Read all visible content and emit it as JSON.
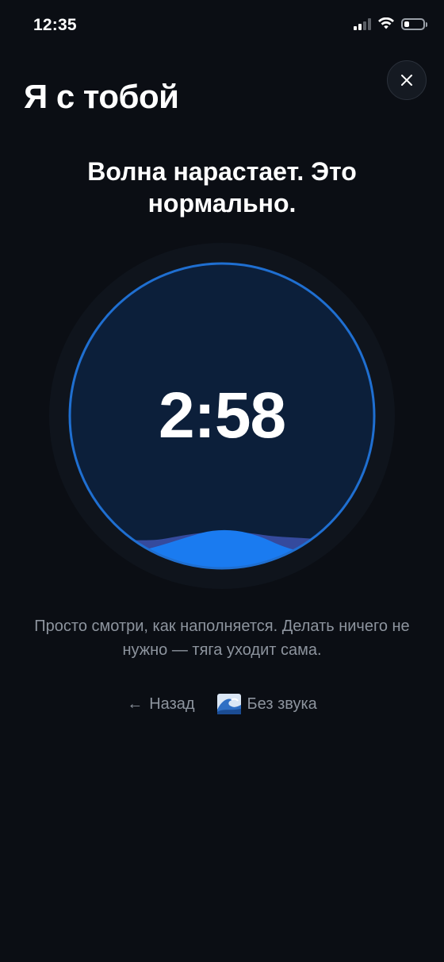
{
  "status_bar": {
    "time": "12:35"
  },
  "header": {
    "title": "Я с тобой",
    "close_icon": "close-icon"
  },
  "main": {
    "headline": "Волна нарастает. Это нормально.",
    "timer": "2:58",
    "hint": "Просто смотри, как наполняется. Делать ничего не нужно — тяга уходит сама."
  },
  "actions": {
    "back_arrow": "←",
    "back_label": "Назад",
    "mute_icon": "wave-emoji-icon",
    "mute_label": "Без звука"
  },
  "colors": {
    "background": "#0b0e14",
    "ring": "#1f6fd1",
    "circle_fill": "#0c1f3a",
    "wave_front": "#1a7bf0",
    "wave_back": "#3a4fa8",
    "muted_text": "#8d949e"
  }
}
